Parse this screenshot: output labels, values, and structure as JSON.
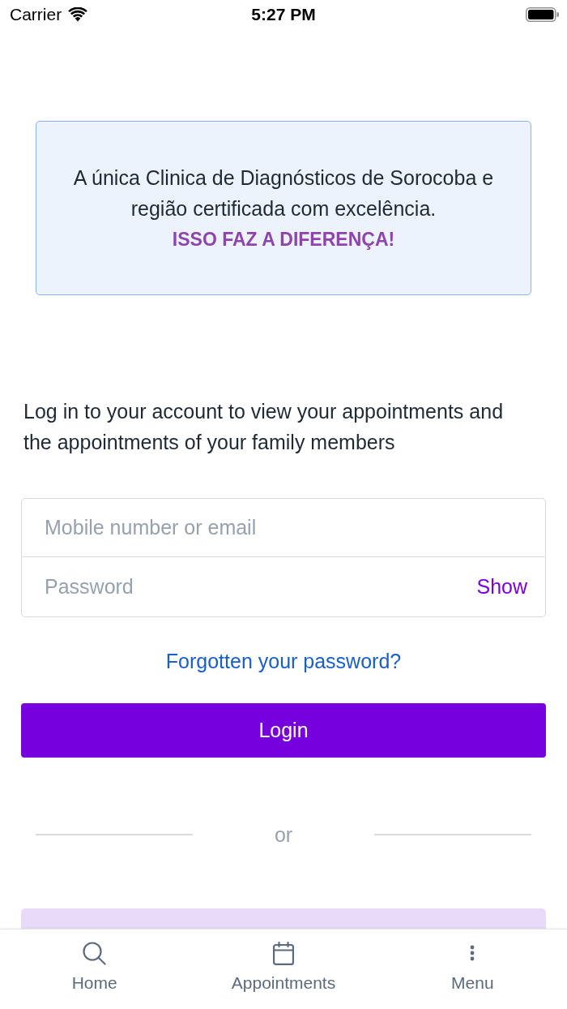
{
  "status_bar": {
    "carrier": "Carrier",
    "time": "5:27 PM"
  },
  "banner": {
    "message": "A única Clinica de Diagnósticos de Sorocoba e região certificada com excelência.",
    "highlight": "ISSO FAZ A DIFERENÇA!"
  },
  "intro": "Log in to your account to view your appointments and the appointments of your family members",
  "login_form": {
    "fields": [
      {
        "placeholder": "Mobile number or email"
      },
      {
        "placeholder": "Password",
        "toggle": "Show"
      }
    ],
    "forgot_link": "Forgotten your password?",
    "submit": "Login",
    "divider": "or"
  },
  "tab_bar": {
    "tabs": [
      {
        "label": "Home",
        "selected": false
      },
      {
        "label": "Appointments",
        "selected": false
      },
      {
        "label": "Menu",
        "selected": false
      }
    ]
  }
}
